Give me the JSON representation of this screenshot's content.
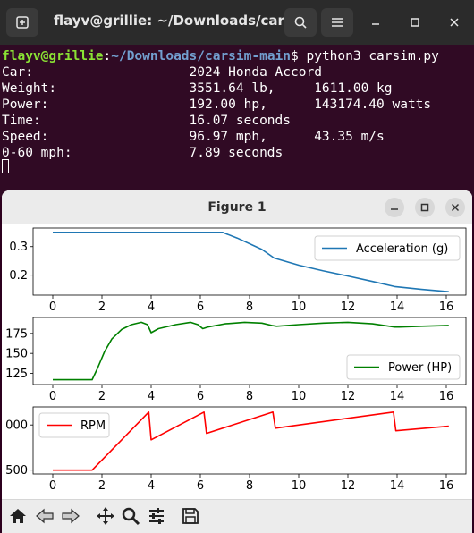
{
  "terminal": {
    "title": "flayv@grillie: ~/Downloads/car...",
    "prompt_user": "flayv@grillie",
    "prompt_sep": ":",
    "prompt_path": "~/Downloads/carsim-main",
    "prompt_cmd": "$ python3 carsim.py",
    "lines": [
      "Car:                    2024 Honda Accord",
      "Weight:                 3551.64 lb,     1611.00 kg",
      "Power:                  192.00 hp,      143174.40 watts",
      "Time:                   16.07 seconds",
      "Speed:                  96.97 mph,      43.35 m/s",
      "0-60 mph:               7.89 seconds"
    ],
    "icons": {
      "new_tab": "new-tab-icon",
      "search": "search-icon",
      "menu": "hamburger-menu-icon",
      "minimize": "minimize-icon",
      "maximize": "maximize-icon",
      "close": "close-icon"
    }
  },
  "figure": {
    "title": "Figure 1",
    "toolbar_icons": [
      "home-icon",
      "back-arrow-icon",
      "forward-arrow-icon",
      "pan-icon",
      "zoom-icon",
      "subplots-config-icon",
      "save-icon"
    ]
  },
  "chart_data": [
    {
      "type": "line",
      "series": [
        {
          "name": "Acceleration (g)",
          "color": "#1f77b4",
          "x": [
            0,
            2,
            4,
            6,
            6.9,
            7.5,
            8.5,
            9,
            10,
            11,
            12,
            13,
            13.9,
            15,
            16.1
          ],
          "y": [
            0.35,
            0.35,
            0.35,
            0.35,
            0.35,
            0.33,
            0.29,
            0.26,
            0.235,
            0.215,
            0.197,
            0.178,
            0.16,
            0.15,
            0.142
          ]
        }
      ],
      "xticks": [
        "0",
        "2",
        "4",
        "6",
        "8",
        "10",
        "12",
        "14",
        "16"
      ],
      "yticks": [
        "0.2",
        "0.3"
      ],
      "xlim": [
        -0.8,
        16.8
      ],
      "ylim": [
        0.13,
        0.365
      ],
      "legend": "top-right"
    },
    {
      "type": "line",
      "series": [
        {
          "name": "Power (HP)",
          "color": "#008000",
          "x": [
            0,
            1.6,
            1.8,
            2.1,
            2.4,
            2.8,
            3.2,
            3.6,
            3.85,
            4.0,
            4.3,
            5.0,
            5.6,
            5.9,
            6.1,
            6.3,
            7.0,
            7.8,
            8.5,
            8.9,
            9.1,
            10,
            11,
            12,
            13,
            13.9,
            14.1,
            15,
            16.1
          ],
          "y": [
            117,
            117,
            130,
            152,
            168,
            180,
            186,
            189,
            186,
            176,
            181,
            186,
            189,
            186,
            181,
            183,
            187,
            189,
            188,
            185,
            184,
            186,
            188,
            189,
            187,
            183,
            183,
            184,
            185
          ]
        }
      ],
      "xticks": [
        "0",
        "2",
        "4",
        "6",
        "8",
        "10",
        "12",
        "14",
        "16"
      ],
      "yticks": [
        "125",
        "150",
        "175"
      ],
      "xlim": [
        -0.8,
        16.8
      ],
      "ylim": [
        111,
        195
      ],
      "legend": "bottom-right"
    },
    {
      "type": "line",
      "series": [
        {
          "name": "RPM",
          "color": "#ff0000",
          "x": [
            0,
            1.6,
            3.9,
            4.0,
            6.15,
            6.25,
            8.95,
            9.05,
            13.85,
            13.95,
            16.1
          ],
          "y": [
            1500,
            1500,
            6000,
            3850,
            6000,
            4350,
            6000,
            4750,
            6000,
            4550,
            4900
          ]
        }
      ],
      "xticks": [
        "0",
        "2",
        "4",
        "6",
        "8",
        "10",
        "12",
        "14",
        "16"
      ],
      "yticks": [
        "500",
        "000"
      ],
      "xlim": [
        -0.8,
        16.8
      ],
      "ylim": [
        1200,
        6400
      ],
      "legend": "top-left"
    }
  ]
}
